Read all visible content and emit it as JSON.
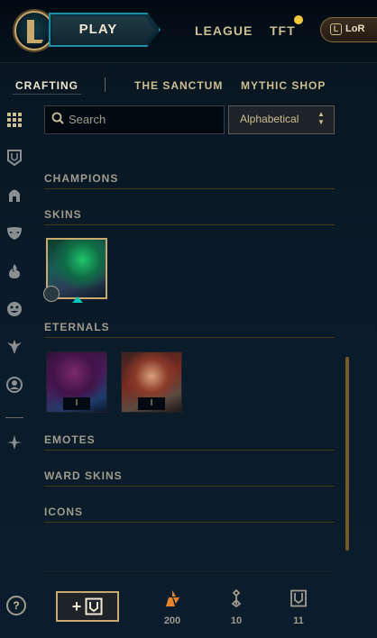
{
  "topbar": {
    "play_label": "PLAY",
    "links": [
      "LEAGUE",
      "TFT"
    ],
    "lor_icon_letter": "L",
    "lor_label": "LoR"
  },
  "subnav": {
    "items": [
      "CRAFTING",
      "THE SANCTUM",
      "MYTHIC SHOP"
    ],
    "active": "CRAFTING"
  },
  "sidebar": {
    "icons": [
      "grid-icon",
      "chest-icon",
      "helmet-icon",
      "mask-icon",
      "flame-icon",
      "emote-icon",
      "ward-icon",
      "profile-icon",
      "eternal-icon"
    ]
  },
  "search": {
    "placeholder": "Search"
  },
  "sort": {
    "selected": "Alphabetical"
  },
  "sections": {
    "champions": "CHAMPIONS",
    "skins": "SKINS",
    "eternals": "ETERNALS",
    "emotes": "EMOTES",
    "ward_skins": "WARD SKINS",
    "icons": "ICONS"
  },
  "eternal_tiles": [
    {
      "badge": "I"
    },
    {
      "badge": "I"
    }
  ],
  "footer": {
    "help": "?",
    "add_label": "+",
    "currencies": [
      {
        "icon": "orange-essence-icon",
        "value": "200",
        "color": "#e8832c"
      },
      {
        "icon": "key-fragment-icon",
        "value": "10",
        "color": "#a09b8c"
      },
      {
        "icon": "chest-icon",
        "value": "11",
        "color": "#a09b8c"
      }
    ]
  },
  "colors": {
    "gold": "#c8aa6e",
    "teal": "#0ac8b9",
    "background": "#0a1a28"
  }
}
